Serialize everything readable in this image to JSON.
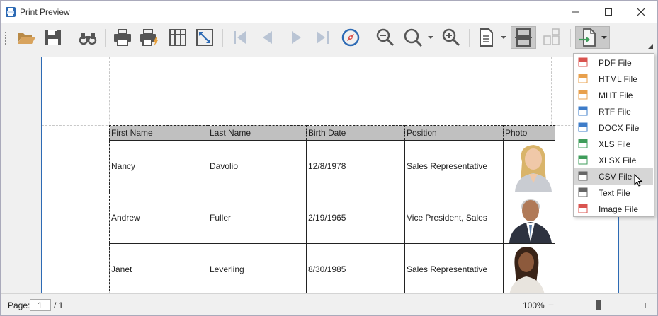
{
  "window": {
    "title": "Print Preview"
  },
  "toolbar": {
    "buttons": [
      "open-icon",
      "save-icon",
      "find-icon",
      "print-icon",
      "quick-print-icon",
      "page-setup-icon",
      "scale-icon",
      "first-page-icon",
      "previous-page-icon",
      "next-page-icon",
      "last-page-icon",
      "navigation-icon",
      "zoom-out-icon",
      "zoom-icon",
      "zoom-in-icon",
      "page-layout-icon",
      "single-page-icon",
      "multiple-pages-icon",
      "export-icon"
    ]
  },
  "table": {
    "columns": [
      "First Name",
      "Last Name",
      "Birth Date",
      "Position",
      "Photo"
    ],
    "rows": [
      {
        "first": "Nancy",
        "last": "Davolio",
        "birth": "12/8/1978",
        "position": "Sales Representative"
      },
      {
        "first": "Andrew",
        "last": "Fuller",
        "birth": "2/19/1965",
        "position": "Vice President, Sales"
      },
      {
        "first": "Janet",
        "last": "Leverling",
        "birth": "8/30/1985",
        "position": "Sales Representative"
      }
    ]
  },
  "export_menu": {
    "items": [
      {
        "label": "PDF File",
        "color": "#d9534f"
      },
      {
        "label": "HTML File",
        "color": "#e8a04c"
      },
      {
        "label": "MHT File",
        "color": "#e8a04c"
      },
      {
        "label": "RTF File",
        "color": "#3d7cc9"
      },
      {
        "label": "DOCX File",
        "color": "#3d7cc9"
      },
      {
        "label": "XLS File",
        "color": "#3f9d5b"
      },
      {
        "label": "XLSX File",
        "color": "#3f9d5b"
      },
      {
        "label": "CSV File",
        "color": "#666666"
      },
      {
        "label": "Text File",
        "color": "#666666"
      },
      {
        "label": "Image File",
        "color": "#d9534f"
      }
    ],
    "hovered_index": 7
  },
  "status": {
    "page_label": "Page:",
    "page_value": "1",
    "page_total": "/ 1",
    "zoom": "100%",
    "zoom_minus": "−",
    "zoom_plus": "+"
  },
  "colors": {
    "accent": "#2d6ab4",
    "icon": "#555555",
    "icon_disabled": "#b9c4d4",
    "folder": "#d8a35d"
  }
}
